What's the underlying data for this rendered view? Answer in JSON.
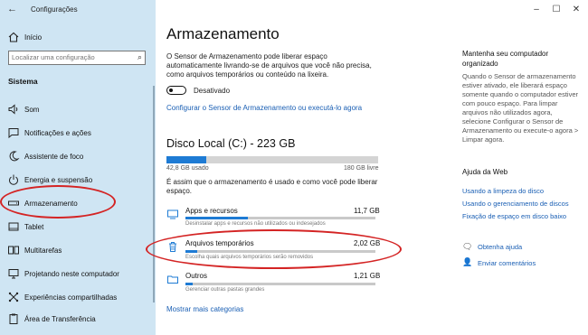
{
  "window": {
    "title": "Configurações",
    "controls": [
      "–",
      "☐",
      "✕"
    ]
  },
  "sidebar": {
    "home_label": "Início",
    "search_placeholder": "Localizar uma configuração",
    "section_title": "Sistema",
    "items": [
      {
        "label": "Som",
        "icon": "speaker-icon"
      },
      {
        "label": "Notificações e ações",
        "icon": "message-icon"
      },
      {
        "label": "Assistente de foco",
        "icon": "moon-icon"
      },
      {
        "label": "Energia e suspensão",
        "icon": "power-icon"
      },
      {
        "label": "Armazenamento",
        "icon": "drive-icon"
      },
      {
        "label": "Tablet",
        "icon": "tablet-icon"
      },
      {
        "label": "Multitarefas",
        "icon": "multitask-icon"
      },
      {
        "label": "Projetando neste computador",
        "icon": "projector-icon"
      },
      {
        "label": "Experiências compartilhadas",
        "icon": "share-icon"
      },
      {
        "label": "Área de Transferência",
        "icon": "clipboard-icon"
      }
    ]
  },
  "main": {
    "title": "Armazenamento",
    "description": "O Sensor de Armazenamento pode liberar espaço automaticamente livrando-se de arquivos que você não precisa, como arquivos temporários ou conteúdo na lixeira.",
    "toggle_state": "Desativado",
    "configure_link": "Configurar o Sensor de Armazenamento ou executá-lo agora",
    "disk": {
      "title": "Disco Local (C:) - 223 GB",
      "used": "42,8 GB usado",
      "free": "180 GB livre",
      "used_fraction": 0.19
    },
    "usage_note": "É assim que o armazenamento é usado e como você pode liberar espaço.",
    "categories": [
      {
        "name": "Apps e recursos",
        "size": "11,7 GB",
        "desc": "Desinstalar apps e recursos não utilizados ou indesejados",
        "fill_fraction": 0.33,
        "icon": "apps-icon"
      },
      {
        "name": "Arquivos temporários",
        "size": "2,02 GB",
        "desc": "Escolha quais arquivos temporários serão removidos",
        "fill_fraction": 0.06,
        "icon": "trash-icon"
      },
      {
        "name": "Outros",
        "size": "1,21 GB",
        "desc": "Gerenciar outras pastas grandes",
        "fill_fraction": 0.04,
        "icon": "folder-icon"
      }
    ],
    "show_more": "Mostrar mais categorias"
  },
  "right": {
    "heading": "Mantenha seu computador organizado",
    "text": "Quando o Sensor de armazenamento estiver ativado, ele liberará espaço somente quando o computador estiver com pouco espaço. Para limpar arquivos não utilizados agora, selecione Configurar o Sensor de Armazenamento ou execute-o agora > Limpar agora.",
    "web_help_heading": "Ajuda da Web",
    "web_links": [
      "Usando a limpeza do disco",
      "Usando o gerenciamento de discos",
      "Fixação de espaço em disco baixo"
    ],
    "get_help": "Obtenha ajuda",
    "feedback": "Enviar comentários"
  },
  "colors": {
    "sidebar_bg": "#cfe5f3",
    "accent": "#1e7bd4",
    "link": "#1a5fb4",
    "annotation": "#d42424"
  }
}
